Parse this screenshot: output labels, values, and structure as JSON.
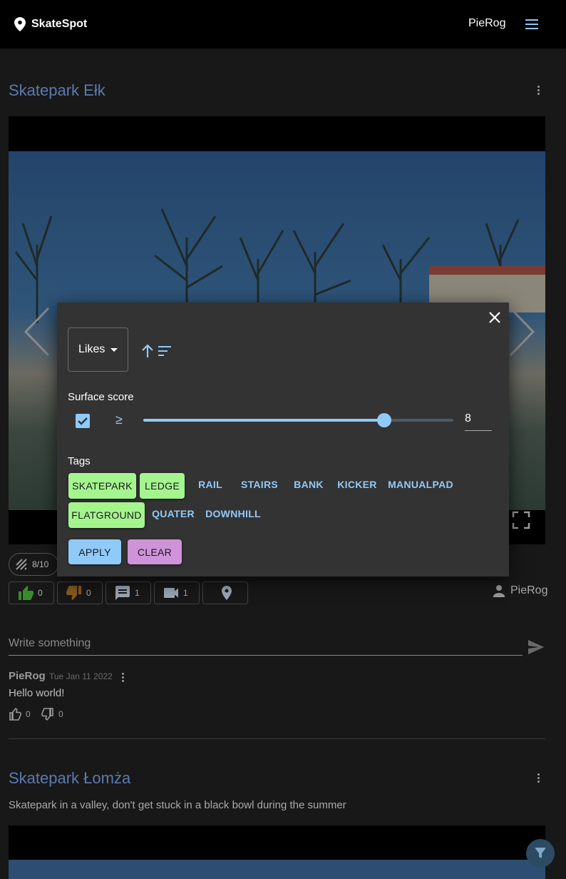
{
  "app": {
    "name": "SkateSpot",
    "user": "PieRog"
  },
  "posts": [
    {
      "title": "Skatepark Ełk",
      "score_chip": "8/10",
      "actions": {
        "likes": "0",
        "dislikes": "0",
        "comments": "1",
        "videos": "1"
      },
      "author": "PieRog",
      "comment_placeholder": "Write something",
      "comments": [
        {
          "author": "PieRog",
          "date": "Tue Jan 11 2022",
          "text": "Hello world!",
          "likes": "0",
          "dislikes": "0"
        }
      ]
    },
    {
      "title": "Skatepark Łomża",
      "description": "Skatepark in a valley, don't get stuck in a black bowl during the summer"
    }
  ],
  "filter_dialog": {
    "sort_by": "Likes",
    "surface_score_label": "Surface score",
    "surface_score_enabled": true,
    "comparator": "≥",
    "surface_score_value": "8",
    "surface_score_fraction": 0.777,
    "tags_label": "Tags",
    "tags": [
      {
        "label": "SKATEPARK",
        "selected": true
      },
      {
        "label": "LEDGE",
        "selected": true
      },
      {
        "label": "RAIL",
        "selected": false
      },
      {
        "label": "STAIRS",
        "selected": false
      },
      {
        "label": "BANK",
        "selected": false
      },
      {
        "label": "KICKER",
        "selected": false
      },
      {
        "label": "MANUALPAD",
        "selected": false
      },
      {
        "label": "FLATGROUND",
        "selected": true
      },
      {
        "label": "QUATER",
        "selected": false
      },
      {
        "label": "DOWNHILL",
        "selected": false
      }
    ],
    "apply_label": "APPLY",
    "clear_label": "CLEAR"
  },
  "colors": {
    "accent": "#90caf9",
    "tag_selected": "#a5f58f",
    "clear": "#ce93d8",
    "title": "#5b7bb0"
  }
}
